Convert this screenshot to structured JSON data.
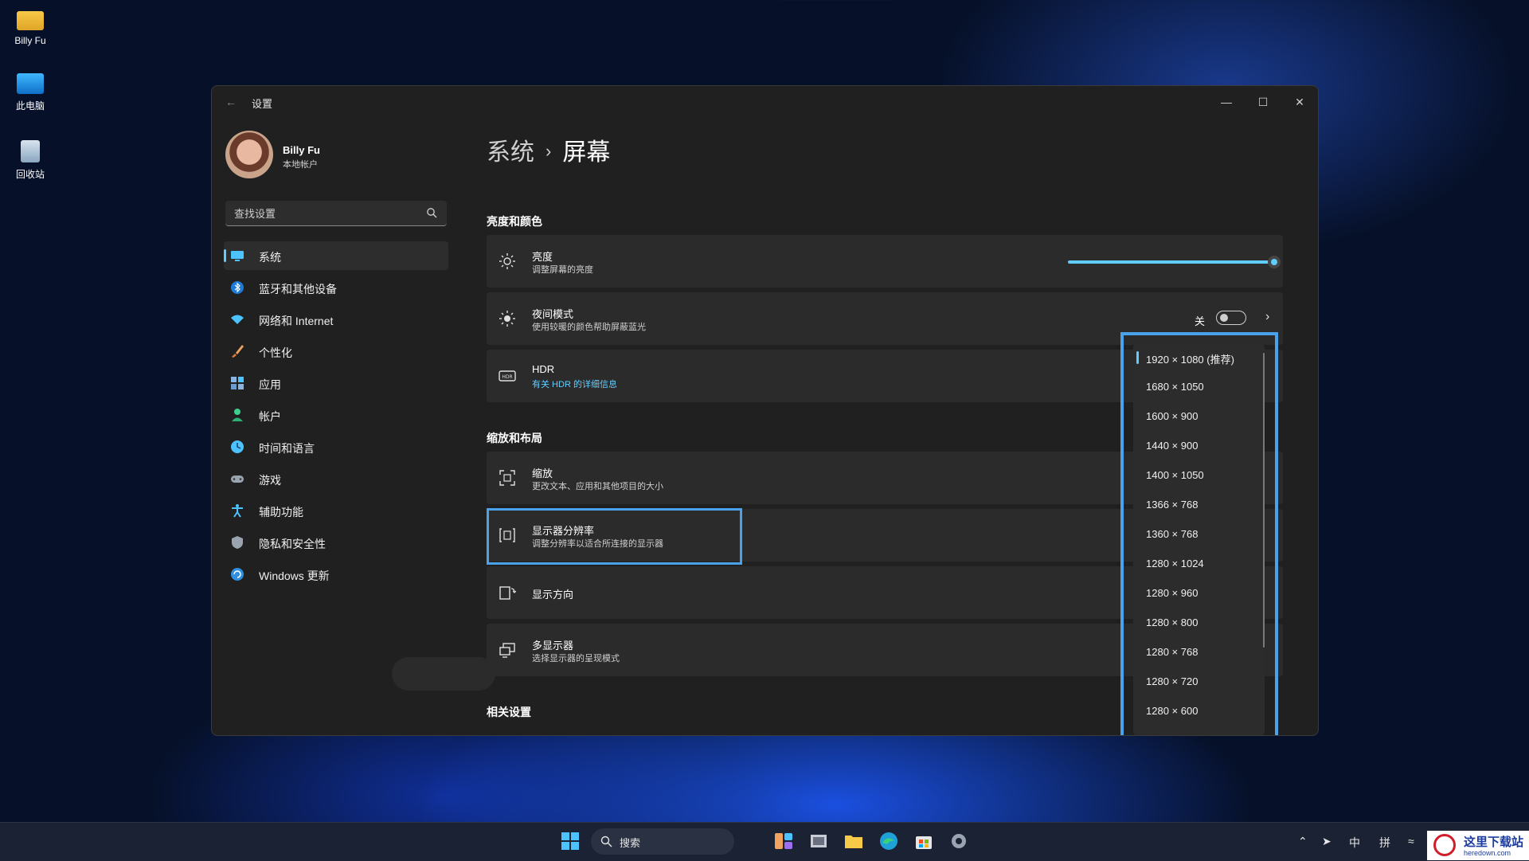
{
  "desktop": {
    "icons": [
      {
        "label": "Billy Fu",
        "icon": "folder-icon"
      },
      {
        "label": "此电脑",
        "icon": "computer-icon"
      },
      {
        "label": "回收站",
        "icon": "recycle-bin-icon"
      }
    ]
  },
  "window": {
    "title": "设置",
    "profile": {
      "name": "Billy Fu",
      "account_type": "本地帐户"
    },
    "search": {
      "placeholder": "查找设置"
    },
    "nav": [
      {
        "label": "系统",
        "icon": "system-icon",
        "active": true
      },
      {
        "label": "蓝牙和其他设备",
        "icon": "bluetooth-icon"
      },
      {
        "label": "网络和 Internet",
        "icon": "network-icon"
      },
      {
        "label": "个性化",
        "icon": "brush-icon"
      },
      {
        "label": "应用",
        "icon": "apps-icon"
      },
      {
        "label": "帐户",
        "icon": "account-icon"
      },
      {
        "label": "时间和语言",
        "icon": "time-language-icon"
      },
      {
        "label": "游戏",
        "icon": "gamepad-icon"
      },
      {
        "label": "辅助功能",
        "icon": "accessibility-icon"
      },
      {
        "label": "隐私和安全性",
        "icon": "shield-icon"
      },
      {
        "label": "Windows 更新",
        "icon": "update-icon"
      }
    ],
    "breadcrumb": {
      "parent": "系统",
      "separator": "›",
      "current": "屏幕"
    },
    "sections": {
      "brightness_color": "亮度和颜色",
      "scale_layout": "缩放和布局",
      "related": "相关设置"
    },
    "brightness": {
      "title": "亮度",
      "subtitle": "调整屏幕的亮度",
      "value_percent": 100
    },
    "night_light": {
      "title": "夜间模式",
      "subtitle": "使用较暖的颜色帮助屏蔽蓝光",
      "state_label": "关",
      "on": false
    },
    "hdr": {
      "title": "HDR",
      "link": "有关 HDR 的详细信息"
    },
    "scale": {
      "title": "缩放",
      "subtitle": "更改文本、应用和其他项目的大小"
    },
    "resolution": {
      "title": "显示器分辨率",
      "subtitle": "调整分辨率以适合所连接的显示器"
    },
    "orientation": {
      "title": "显示方向"
    },
    "multi_display": {
      "title": "多显示器",
      "subtitle": "选择显示器的呈现模式"
    },
    "resolution_options": [
      "1920 × 1080 (推荐)",
      "1680 × 1050",
      "1600 × 900",
      "1440 × 900",
      "1400 × 1050",
      "1366 × 768",
      "1360 × 768",
      "1280 × 1024",
      "1280 × 960",
      "1280 × 800",
      "1280 × 768",
      "1280 × 720",
      "1280 × 600"
    ],
    "selected_resolution_index": 0
  },
  "taskbar": {
    "search_label": "搜索",
    "tray": {
      "ime_lang": "中",
      "ime_mode": "拼"
    }
  },
  "watermark": {
    "text": "这里下载站",
    "url": "heredown.com"
  },
  "colors": {
    "accent": "#60cdff",
    "highlight": "#4aa3ea",
    "window_bg": "#202020",
    "card_bg": "#2b2b2b"
  }
}
